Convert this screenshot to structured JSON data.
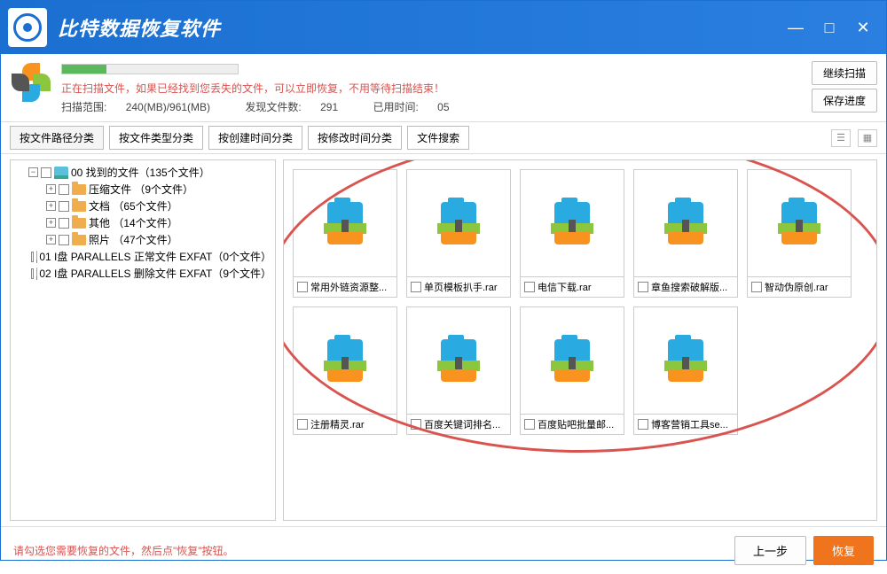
{
  "app_title": "比特数据恢复软件",
  "window": {
    "min": "—",
    "max": "□",
    "close": "✕"
  },
  "scan": {
    "message": "正在扫描文件，如果已经找到您丢失的文件，可以立即恢复，不用等待扫描结束！",
    "range_label": "扫描范围:",
    "range_value": "240(MB)/961(MB)",
    "found_label": "发现文件数:",
    "found_value": "291",
    "time_label": "已用时间:",
    "time_value": "05"
  },
  "btns": {
    "continue": "继续扫描",
    "save_progress": "保存进度",
    "prev": "上一步",
    "recover": "恢复"
  },
  "tabs": [
    "按文件路径分类",
    "按文件类型分类",
    "按创建时间分类",
    "按修改时间分类",
    "文件搜索"
  ],
  "tree": [
    {
      "exp": "−",
      "icon": "disk",
      "label": "00 找到的文件（135个文件）",
      "indent": 1
    },
    {
      "exp": "+",
      "icon": "folder",
      "label": "压缩文件  （9个文件）",
      "indent": 2
    },
    {
      "exp": "+",
      "icon": "folder",
      "label": "文档  （65个文件）",
      "indent": 2
    },
    {
      "exp": "+",
      "icon": "folder",
      "label": "其他  （14个文件）",
      "indent": 2
    },
    {
      "exp": "+",
      "icon": "folder",
      "label": "照片  （47个文件）",
      "indent": 2
    },
    {
      "exp": "",
      "icon": "disk",
      "label": "01 I盘 PARALLELS 正常文件 EXFAT（0个文件）",
      "indent": 1
    },
    {
      "exp": "",
      "icon": "disk",
      "label": "02 I盘 PARALLELS 删除文件 EXFAT（9个文件）",
      "indent": 1
    }
  ],
  "files": [
    "常用外链资源整...",
    "单页模板扒手.rar",
    "电信下载.rar",
    "章鱼搜索破解版...",
    "智动伪原创.rar",
    "注册精灵.rar",
    "百度关键词排名...",
    "百度贴吧批量邮...",
    "博客营销工具se..."
  ],
  "footer_msg": "请勾选您需要恢复的文件，然后点\"恢复\"按钮。"
}
